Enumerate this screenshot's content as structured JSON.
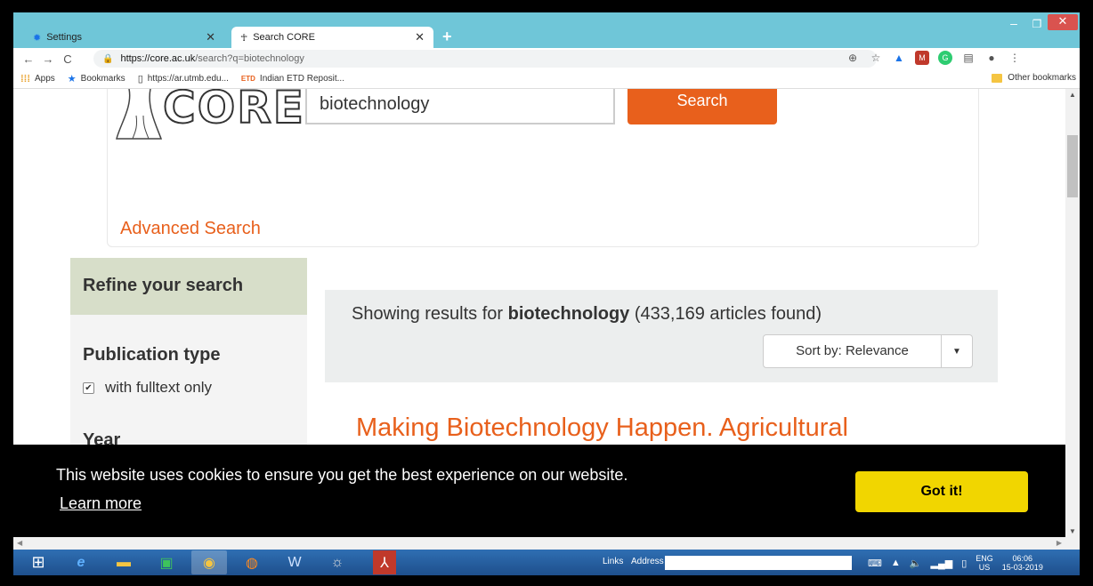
{
  "browser": {
    "tabs": [
      {
        "title": "Settings",
        "icon": "gear-icon",
        "active": false
      },
      {
        "title": "Search CORE",
        "icon": "core-favicon",
        "active": true
      }
    ],
    "url_host": "https://core.ac.uk",
    "url_path": "/search?q=biotechnology",
    "bookmarks": [
      {
        "label": "Apps",
        "icon": "apps-grid-icon"
      },
      {
        "label": "Bookmarks",
        "icon": "star-icon"
      },
      {
        "label": "https://ar.utmb.edu...",
        "icon": "page-icon"
      },
      {
        "label": "Indian ETD Reposit...",
        "icon": "etd-favicon"
      }
    ],
    "other_bookmarks": "Other bookmarks"
  },
  "page": {
    "logo_text": "CORE",
    "search_value": "biotechnology",
    "search_button": "Search",
    "advanced_search": "Advanced Search",
    "sidebar": {
      "refine_title": "Refine your search",
      "publication_type": "Publication type",
      "fulltext_label": "with fulltext only",
      "fulltext_checked": true,
      "year_label": "Year"
    },
    "results": {
      "prefix": "Showing results for ",
      "query": "biotechnology",
      "count": "(433,169 articles found)",
      "sort_label": "Sort by: Relevance"
    },
    "first_result_title": "Making Biotechnology Happen. Agricultural Biotechnology Policy"
  },
  "cookie_banner": {
    "message": "This website uses cookies to ensure you get the best experience on our website.",
    "learn_more": "Learn more",
    "button": "Got it!"
  },
  "taskbar": {
    "links_label": "Links",
    "address_label": "Address",
    "language_top": "ENG",
    "language_bottom": "US",
    "time": "06:06",
    "date": "15-03-2019"
  }
}
